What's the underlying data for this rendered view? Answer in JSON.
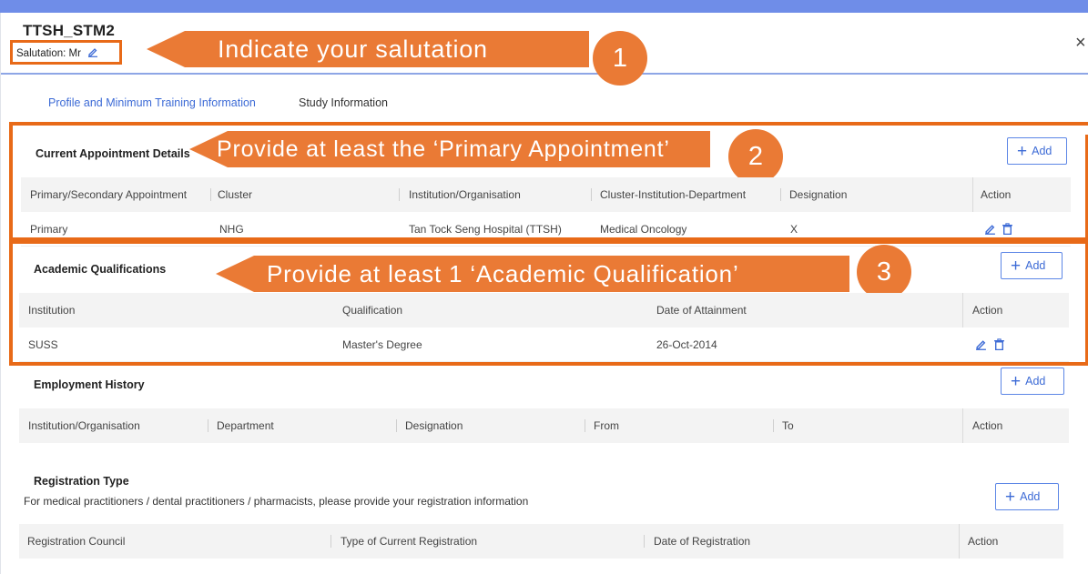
{
  "modal": {
    "title": "TTSH_STM2",
    "salutation": "Salutation: Mr",
    "close": "×"
  },
  "callouts": {
    "c1": {
      "text": "Indicate your salutation",
      "badge": "1"
    },
    "c2": {
      "text": "Provide at least the ‘Primary Appointment’",
      "badge": "2"
    },
    "c3": {
      "text": "Provide at least 1 ‘Academic Qualification’",
      "badge": "3"
    }
  },
  "tabs": [
    "Profile and Minimum Training Information",
    "Study Information"
  ],
  "add_label": "Add",
  "appointment": {
    "title": "Current Appointment Details",
    "columns": [
      "Primary/Secondary Appointment",
      "Cluster",
      "Institution/Organisation",
      "Cluster-Institution-Department",
      "Designation",
      "Action"
    ],
    "row": [
      "Primary",
      "NHG",
      "Tan Tock Seng Hospital (TTSH)",
      "Medical Oncology",
      "X"
    ]
  },
  "academic": {
    "title": "Academic Qualifications",
    "columns": [
      "Institution",
      "Qualification",
      "Date of Attainment",
      "Action"
    ],
    "row": [
      "SUSS",
      "Master's Degree",
      "26-Oct-2014"
    ]
  },
  "employment": {
    "title": "Employment History",
    "columns": [
      "Institution/Organisation",
      "Department",
      "Designation",
      "From",
      "To",
      "Action"
    ]
  },
  "registration": {
    "title": "Registration Type",
    "description": "For medical practitioners / dental practitioners / pharmacists, please provide your registration information",
    "columns": [
      "Registration Council",
      "Type of Current Registration",
      "Date of Registration",
      "Action"
    ]
  },
  "colors": {
    "accent": "#3d6bd6",
    "callout": "#ea7a35",
    "frame": "#e86a18",
    "header_bg": "#f3f3f3",
    "top_band": "#6f8de8"
  }
}
